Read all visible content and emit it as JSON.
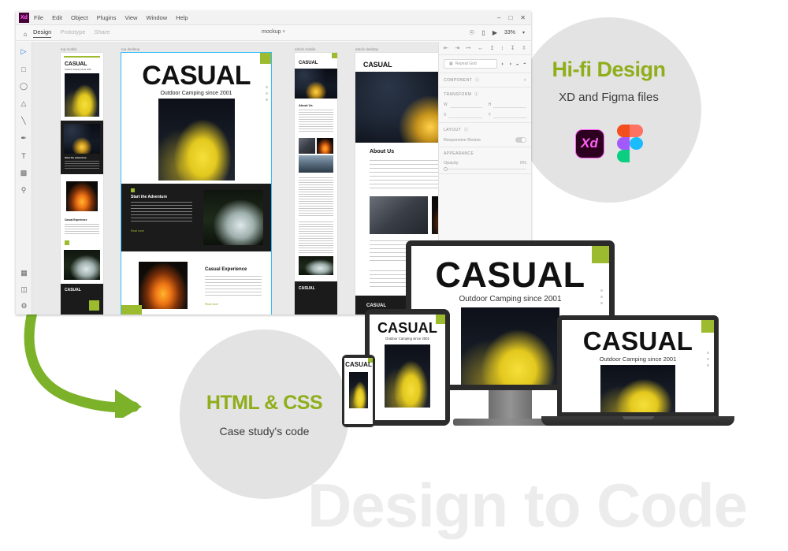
{
  "watermark": {
    "text": "Design to Code"
  },
  "badges": {
    "hifi": {
      "title": "Hi-fi Design",
      "subtitle": "XD and Figma files",
      "logos": [
        {
          "name": "adobe-xd-logo",
          "label": "Xd"
        },
        {
          "name": "figma-logo",
          "label": ""
        }
      ]
    },
    "html": {
      "title": "HTML & CSS",
      "subtitle": "Case study's code"
    }
  },
  "xd_window": {
    "app_logo": "Xd",
    "menu": [
      "File",
      "Edit",
      "Object",
      "Plugins",
      "View",
      "Window",
      "Help"
    ],
    "window_controls": {
      "minimize": "–",
      "maximize": "□",
      "close": "✕"
    },
    "tabs": [
      {
        "label": "Design",
        "active": true
      },
      {
        "label": "Prototype",
        "active": false
      },
      {
        "label": "Share",
        "active": false
      }
    ],
    "document_name": "mockup",
    "zoom": "33%",
    "home_icon": "home-icon",
    "subbar_icons": [
      "cloud-icon",
      "device-preview-icon",
      "play-icon"
    ],
    "tools": [
      "select-tool",
      "rectangle-tool",
      "ellipse-tool",
      "polygon-tool",
      "line-tool",
      "pen-tool",
      "text-tool",
      "artboard-tool",
      "zoom-tool"
    ],
    "tools_bottom": [
      "assets-icon",
      "layers-icon",
      "plugins-icon"
    ],
    "right_panel": {
      "align_icons": [
        "align-left",
        "align-center-h",
        "align-right",
        "distribute-h",
        "align-top",
        "align-middle-v",
        "align-bottom",
        "distribute-v"
      ],
      "repeat_grid_label": "Repeat Grid",
      "boolean_icons": [
        "add",
        "subtract",
        "intersect",
        "exclude"
      ],
      "sections": [
        {
          "title": "COMPONENT",
          "expand": "+"
        },
        {
          "title": "TRANSFORM"
        },
        {
          "title": "LAYOUT"
        },
        {
          "title": "APPEARANCE"
        }
      ],
      "transform_fields": [
        {
          "label": "W",
          "value": ""
        },
        {
          "label": "H",
          "value": ""
        },
        {
          "label": "X",
          "value": ""
        },
        {
          "label": "Y",
          "value": ""
        }
      ],
      "responsive_resize_label": "Responsive Resize",
      "responsive_resize_on": true,
      "opacity_label": "Opacity",
      "opacity_value": "0%"
    },
    "artboards": [
      {
        "name": "top mobile",
        "label": "top mobile"
      },
      {
        "name": "top desktop",
        "label": "top desktop"
      },
      {
        "name": "article mobile",
        "label": "article mobile"
      },
      {
        "name": "article desktop",
        "label": "article desktop"
      }
    ]
  },
  "site": {
    "brand": "CASUAL",
    "tagline": "Outdoor Camping since 2001",
    "headings": {
      "start_adventure": "Start the Adventure",
      "casual_experience": "Casual Experience",
      "about_us": "About Us"
    },
    "cta": "Read more",
    "footer_brand": "CASUAL"
  },
  "devices": [
    {
      "name": "desktop-monitor-mockup",
      "brand": "CASUAL",
      "tagline": "Outdoor Camping since 2001"
    },
    {
      "name": "laptop-mockup",
      "brand": "CASUAL",
      "tagline": "Outdoor Camping since 2001"
    },
    {
      "name": "tablet-mockup",
      "brand": "CASUAL",
      "tagline": "Outdoor Camping since 2001"
    },
    {
      "name": "phone-mockup",
      "brand": "CASUAL",
      "tagline": ""
    }
  ],
  "colors": {
    "accent_green": "#8fae1b",
    "arrow_green": "#7cb229",
    "badge_grey": "#e3e3e3",
    "watermark_grey": "#ececed",
    "artboard_green": "#9cbb2e",
    "dark": "#1b1b1b"
  }
}
